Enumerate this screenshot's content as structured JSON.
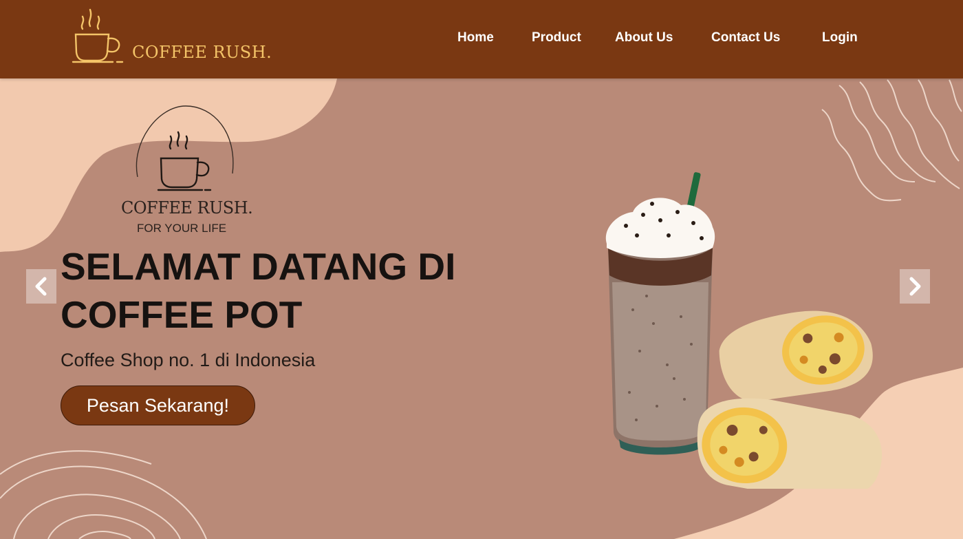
{
  "header": {
    "brand_name": "COFFEE RUSH.",
    "logo_icon": "coffee-cup-icon",
    "nav": [
      {
        "label": "Home"
      },
      {
        "label": "Product"
      },
      {
        "label": "About Us"
      },
      {
        "label": "Contact Us"
      },
      {
        "label": "Login"
      }
    ]
  },
  "hero": {
    "brand_name": "COFFEE RUSH.",
    "tagline": "FOR YOUR LIFE",
    "headline_line1": "SELAMAT DATANG DI",
    "headline_line2": "COFFEE POT",
    "subtitle": "Coffee Shop no. 1 di Indonesia",
    "cta_label": "Pesan Sekarang!",
    "prev_icon": "chevron-left-icon",
    "next_icon": "chevron-right-icon",
    "product_image": "frappe-and-burrito-image"
  },
  "colors": {
    "header_bg": "#7a3812",
    "brand_gold": "#f4c468",
    "hero_bg": "#b98a78",
    "accent_cream": "#f4cdb3",
    "button_bg": "#7a3812"
  }
}
